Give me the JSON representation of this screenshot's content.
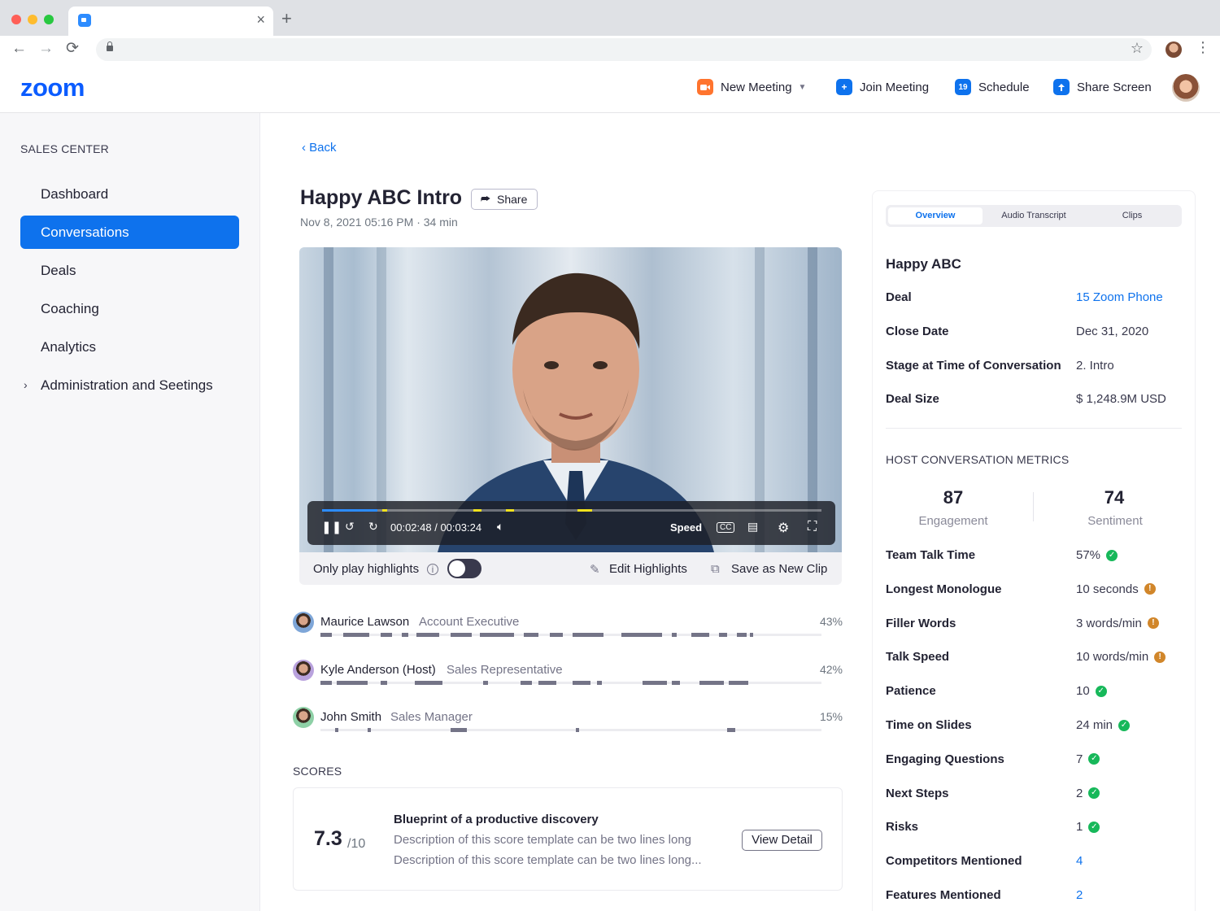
{
  "browser": {
    "new_tab": "+",
    "tab_close": "×",
    "back": "←",
    "forward": "→",
    "reload": "⟳",
    "star": "☆",
    "menu": "⋮"
  },
  "app": {
    "logo": "zoom",
    "actions": {
      "new_meeting": "New Meeting",
      "join_meeting": "Join Meeting",
      "schedule": "Schedule",
      "share_screen": "Share Screen"
    },
    "schedule_day": "19"
  },
  "sidebar": {
    "title": "SALES CENTER",
    "items": [
      {
        "label": "Dashboard"
      },
      {
        "label": "Conversations",
        "active": true
      },
      {
        "label": "Deals"
      },
      {
        "label": "Coaching"
      },
      {
        "label": "Analytics"
      },
      {
        "label": "Administration and Seetings",
        "expandable": true
      }
    ]
  },
  "main": {
    "back": "Back",
    "title": "Happy ABC Intro",
    "share": "Share",
    "subtitle": "Nov 8, 2021 05:16 PM · 34 min",
    "player": {
      "time": "00:02:48 / 00:03:24",
      "speed": "Speed",
      "progress": 0.82
    },
    "footer": {
      "only_highlights": "Only play highlights",
      "highlights_on": false,
      "edit_highlights": "Edit Highlights",
      "save_clip": "Save as New Clip"
    },
    "speakers": [
      {
        "name": "Maurice Lawson",
        "role": "Account Executive",
        "pct": "43%",
        "avatar_color": "#7ea6d8"
      },
      {
        "name": "Kyle Anderson (Host)",
        "role": "Sales Representative",
        "pct": "42%",
        "avatar_color": "#b9a2dd"
      },
      {
        "name": "John Smith",
        "role": "Sales Manager",
        "pct": "15%",
        "avatar_color": "#8ed0a6"
      }
    ],
    "scores_title": "SCORES",
    "score": {
      "value": "7.3",
      "denominator": "/10",
      "name": "Blueprint of a productive discovery",
      "desc1": "Description of this score template can be two lines long",
      "desc2": "Description of this score template can be two lines long...",
      "view_detail": "View Detail"
    }
  },
  "panel": {
    "tabs": [
      "Overview",
      "Audio Transcript",
      "Clips"
    ],
    "company": "Happy ABC",
    "deal_fields": [
      {
        "label": "Deal",
        "value": "15 Zoom Phone",
        "link": true
      },
      {
        "label": "Close Date",
        "value": "Dec 31, 2020"
      },
      {
        "label": "Stage at Time of Conversation",
        "value": "2. Intro"
      },
      {
        "label": "Deal Size",
        "value": "$ 1,248.9M USD"
      }
    ],
    "metrics_title": "HOST CONVERSATION METRICS",
    "engagement": {
      "value": "87",
      "label": "Engagement"
    },
    "sentiment": {
      "value": "74",
      "label": "Sentiment"
    },
    "metrics": [
      {
        "label": "Team Talk Time",
        "value": "57%",
        "status": "ok"
      },
      {
        "label": "Longest Monologue",
        "value": "10 seconds",
        "status": "warn"
      },
      {
        "label": "Filler Words",
        "value": "3 words/min",
        "status": "warn"
      },
      {
        "label": "Talk Speed",
        "value": "10 words/min",
        "status": "warn"
      },
      {
        "label": "Patience",
        "value": "10",
        "status": "ok"
      },
      {
        "label": "Time on Slides",
        "value": "24 min",
        "status": "ok"
      },
      {
        "label": "Engaging Questions",
        "value": "7",
        "status": "ok"
      },
      {
        "label": "Next Steps",
        "value": "2",
        "status": "ok"
      },
      {
        "label": "Risks",
        "value": "1",
        "status": "ok"
      },
      {
        "label": "Competitors Mentioned",
        "value": "4",
        "link": true
      },
      {
        "label": "Features Mentioned",
        "value": "2",
        "link": true
      }
    ]
  }
}
